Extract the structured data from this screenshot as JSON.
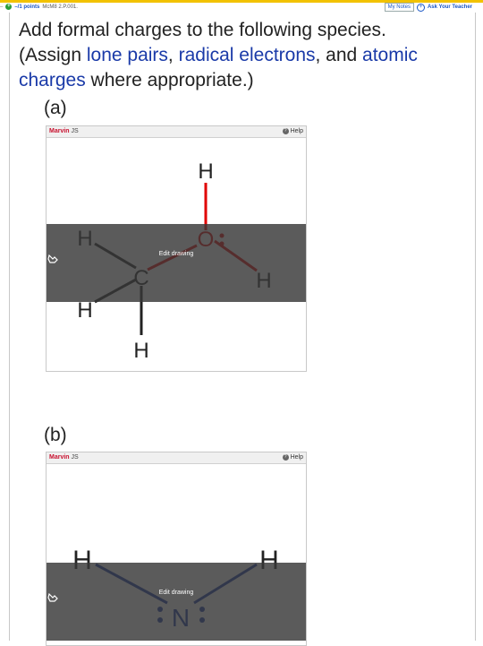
{
  "header": {
    "points": "–/1 points",
    "problem_id": "McM8 2.P.001.",
    "my_notes": "My Notes",
    "ask_teacher": "Ask Your Teacher",
    "accent": "#f2c200"
  },
  "question": {
    "line1": "Add formal charges to the following species.",
    "l2_a": "(Assign ",
    "l2_lone": "lone pairs",
    "l2_b": ", ",
    "l2_radical": "radical electrons",
    "l2_c": ", and ",
    "l2_atomic": "atomic",
    "l3_charges": "charges",
    "l3_rest": " where appropriate.)",
    "link_color": "#1a3aa8"
  },
  "parts": [
    {
      "label": "(a)",
      "editor_brand": "Marvin",
      "editor_suffix": " JS",
      "help": "Help",
      "edit_label": "Edit drawing",
      "atoms": {
        "h_top": "H",
        "o": "O",
        "h_right": "H",
        "h_left_top": "H",
        "c": "C",
        "h_left_bottom": "H",
        "h_bottom": "H"
      }
    },
    {
      "label": "(b)",
      "editor_brand": "Marvin",
      "editor_suffix": " JS",
      "help": "Help",
      "edit_label": "Edit drawing",
      "atoms": {
        "h_left": "H",
        "n": "N",
        "h_right": "H"
      }
    }
  ],
  "colors": {
    "oxygen": "#e00000",
    "nitrogen": "#1a3aa8",
    "overlay": "#3a3a3a"
  }
}
